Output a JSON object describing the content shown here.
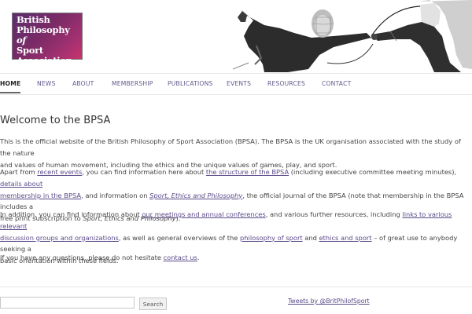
{
  "logo": {
    "line1": "British",
    "line2a": "Philosophy ",
    "line2b": "of",
    "line3": "Sport",
    "line4": "Association"
  },
  "hero": {
    "icon": "fencers-photo"
  },
  "nav": {
    "items": [
      {
        "label": "HOME"
      },
      {
        "label": "NEWS"
      },
      {
        "label": "ABOUT"
      },
      {
        "label": "MEMBERSHIP"
      },
      {
        "label": "PUBLICATIONS"
      },
      {
        "label": "EVENTS"
      },
      {
        "label": "RESOURCES"
      },
      {
        "label": "CONTACT"
      }
    ]
  },
  "main": {
    "title": "Welcome to the BPSA",
    "p1": {
      "line1": "This is the official website of the British Philosophy of Sport Association (BPSA). The BPSA is the UK organisation associated with the study of the nature",
      "line2": "and values of human movement, including the ethics and the unique values of games, play, and sport."
    },
    "p2": {
      "t1": "Apart from ",
      "l1": "recent events",
      "t2": ", you can find information here about ",
      "l2": "the structure of the BPSA",
      "t3": " (including executive committee meeting minutes), ",
      "l3a": "details about",
      "l3b": "membership in the BPSA",
      "t4": ", and information on ",
      "l4": "Sport, Ethics and Philosophy",
      "t5": ", the official journal of the BPSA (note that membership in the BPSA includes a",
      "t6": "free print subscription to ",
      "i1": "Sport, Ethics and Philosophy",
      "t7": ")."
    },
    "p3": {
      "t1": "In addition, you can find information about ",
      "l1": "our meetings and annual conferences",
      "t2": ", and various further resources, including ",
      "l2a": "links to various relevant",
      "l2b": "discussion groups and organizations",
      "t3": ", as well as general overviews of the ",
      "l3": "philosophy of sport",
      "t4": " and ",
      "l4": "ethics and sport",
      "t5": " – of great use to anybody seeking a",
      "t6": "basic orientation within these fields."
    },
    "p4": {
      "t1": "If you have any questions, please do not hesitate ",
      "l1": "contact us",
      "t2": "."
    }
  },
  "footer": {
    "search_value": "",
    "search_button": "Search",
    "tweets_link": "Tweets by @BritPhilofSport"
  }
}
